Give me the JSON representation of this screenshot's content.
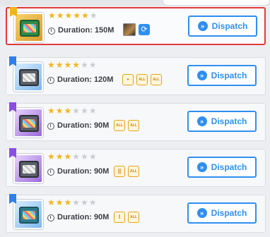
{
  "dispatch_list": {
    "items": [
      {
        "rarity": "gold",
        "stars_filled": 5,
        "stars_total": 6,
        "duration": "Duration: 150M",
        "requirements": [],
        "has_character_portrait": true,
        "has_refresh": true,
        "dispatch_label": "Dispatch",
        "selected": true
      },
      {
        "rarity": "blue",
        "stars_filled": 4,
        "stars_total": 6,
        "duration": "Duration: 120M",
        "requirements": [
          {
            "icon": "gear-badge-icon",
            "text": ""
          },
          {
            "icon": "all-badge-icon",
            "text": "ALL"
          },
          {
            "icon": "all-badge-icon",
            "text": "ALL"
          }
        ],
        "dispatch_label": "Dispatch",
        "selected": false
      },
      {
        "rarity": "purple",
        "stars_filled": 3,
        "stars_total": 6,
        "duration": "Duration: 90M",
        "requirements": [
          {
            "icon": "all-badge-icon",
            "text": "ALL"
          },
          {
            "icon": "all-badge-icon",
            "text": "ALL"
          }
        ],
        "dispatch_label": "Dispatch",
        "selected": false
      },
      {
        "rarity": "purple",
        "stars_filled": 3,
        "stars_total": 6,
        "duration": "Duration: 90M",
        "requirements": [
          {
            "icon": "pause-badge-icon",
            "text": "||"
          },
          {
            "icon": "all-badge-icon",
            "text": "ALL"
          }
        ],
        "dispatch_label": "Dispatch",
        "selected": false
      },
      {
        "rarity": "blue",
        "stars_filled": 3,
        "stars_total": 6,
        "duration": "Duration: 90M",
        "requirements": [
          {
            "icon": "hourglass-badge-icon",
            "text": "I"
          },
          {
            "icon": "all-badge-icon",
            "text": "ALL"
          }
        ],
        "dispatch_label": "Dispatch",
        "selected": false
      }
    ]
  },
  "colors": {
    "accent": "#2f8ff0",
    "star_on": "#f3b51f",
    "star_off": "#c9ccd1",
    "selected_border": "#e23b3b"
  }
}
